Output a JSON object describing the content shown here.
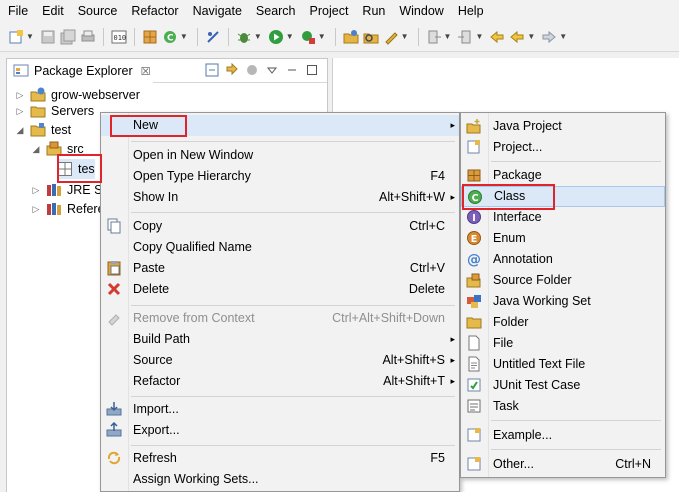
{
  "menubar": {
    "items": [
      "File",
      "Edit",
      "Source",
      "Refactor",
      "Navigate",
      "Search",
      "Project",
      "Run",
      "Window",
      "Help"
    ]
  },
  "toolbar": {
    "icons": [
      "new-icon",
      "save-icon",
      "save-all-icon",
      "print-icon",
      "binary-icon",
      "build-icon",
      "new-class-icon",
      "skip-icon",
      "debug-icon",
      "run-icon",
      "external-tools-icon",
      "open-type-icon",
      "search-icon",
      "pen-icon",
      "nav-forward-icon",
      "nav-back-icon",
      "back-icon",
      "forward-icon"
    ]
  },
  "view": {
    "tab_title": "Package Explorer",
    "close_symbol": "☒"
  },
  "tree": {
    "items": [
      {
        "label": "grow-webserver",
        "icon": "project-icon",
        "twisty": "▷"
      },
      {
        "label": "Servers",
        "icon": "folder-icon",
        "twisty": "▷"
      },
      {
        "label": "test",
        "icon": "project-icon",
        "twisty": "◢"
      },
      {
        "label": "src",
        "icon": "package-folder-icon",
        "twisty": "◢"
      },
      {
        "label": "tes",
        "icon": "package-icon",
        "twisty": ""
      },
      {
        "label": "JRE Sy",
        "icon": "library-icon",
        "twisty": "▷"
      },
      {
        "label": "Refere",
        "icon": "library-icon",
        "twisty": "▷"
      }
    ]
  },
  "context_menu": {
    "items": [
      {
        "label": "New",
        "shortcut": "",
        "submenu": true
      },
      {
        "label": "Open in New Window",
        "shortcut": ""
      },
      {
        "label": "Open Type Hierarchy",
        "shortcut": "F4"
      },
      {
        "label": "Show In",
        "shortcut": "Alt+Shift+W",
        "submenu": true
      },
      {
        "label": "Copy",
        "shortcut": "Ctrl+C"
      },
      {
        "label": "Copy Qualified Name",
        "shortcut": ""
      },
      {
        "label": "Paste",
        "shortcut": "Ctrl+V"
      },
      {
        "label": "Delete",
        "shortcut": "Delete"
      },
      {
        "label": "Remove from Context",
        "shortcut": "Ctrl+Alt+Shift+Down",
        "disabled": true
      },
      {
        "label": "Build Path",
        "shortcut": "",
        "submenu": true
      },
      {
        "label": "Source",
        "shortcut": "Alt+Shift+S",
        "submenu": true
      },
      {
        "label": "Refactor",
        "shortcut": "Alt+Shift+T",
        "submenu": true
      },
      {
        "label": "Import...",
        "shortcut": ""
      },
      {
        "label": "Export...",
        "shortcut": ""
      },
      {
        "label": "Refresh",
        "shortcut": "F5"
      },
      {
        "label": "Assign Working Sets...",
        "shortcut": ""
      }
    ]
  },
  "submenu": {
    "items": [
      {
        "label": "Java Project",
        "shortcut": ""
      },
      {
        "label": "Project...",
        "shortcut": ""
      },
      {
        "label": "Package",
        "shortcut": ""
      },
      {
        "label": "Class",
        "shortcut": ""
      },
      {
        "label": "Interface",
        "shortcut": ""
      },
      {
        "label": "Enum",
        "shortcut": ""
      },
      {
        "label": "Annotation",
        "shortcut": ""
      },
      {
        "label": "Source Folder",
        "shortcut": ""
      },
      {
        "label": "Java Working Set",
        "shortcut": ""
      },
      {
        "label": "Folder",
        "shortcut": ""
      },
      {
        "label": "File",
        "shortcut": ""
      },
      {
        "label": "Untitled Text File",
        "shortcut": ""
      },
      {
        "label": "JUnit Test Case",
        "shortcut": ""
      },
      {
        "label": "Task",
        "shortcut": ""
      },
      {
        "label": "Example...",
        "shortcut": ""
      },
      {
        "label": "Other...",
        "shortcut": "Ctrl+N"
      }
    ]
  },
  "symbols": {
    "submenu_arrow": "▸"
  },
  "colors": {
    "highlight": "#dbe8f7",
    "annotation_red": "#e0242a",
    "disabled_text": "#8f8f8f"
  }
}
